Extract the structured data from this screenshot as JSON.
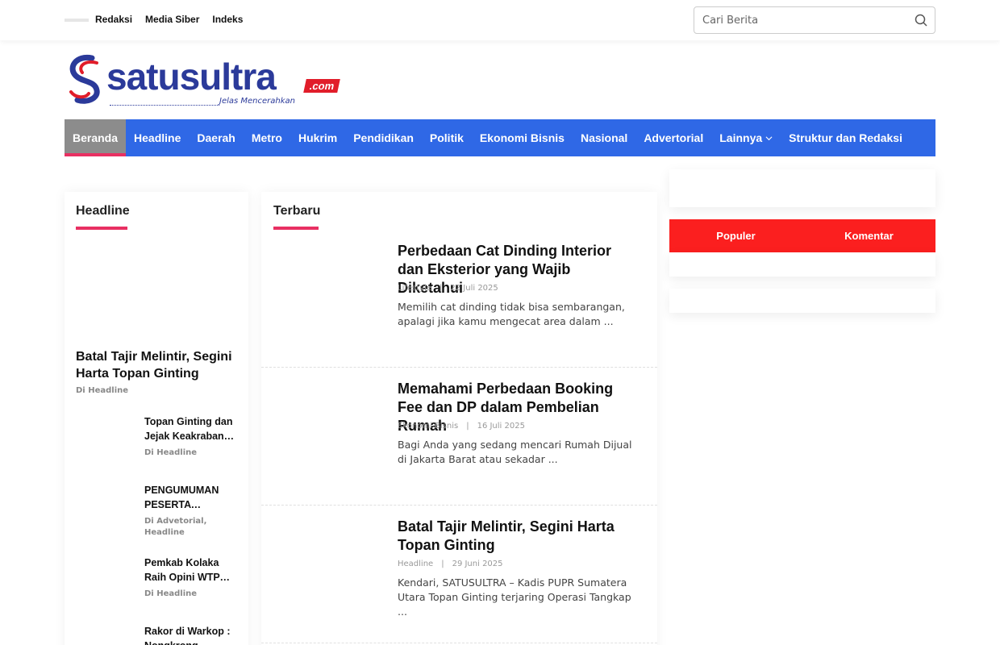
{
  "topbar": {
    "links": [
      "Redaksi",
      "Media Siber",
      "Indeks"
    ],
    "search_placeholder": "Cari Berita"
  },
  "logo": {
    "brand": "satusultra",
    "suffix": ".com",
    "tagline": "Jelas Mencerahkan",
    "colors": {
      "primary": "#2b3a9a",
      "accent": "#e11d2a"
    }
  },
  "nav": {
    "items": [
      "Beranda",
      "Headline",
      "Daerah",
      "Metro",
      "Hukrim",
      "Pendidikan",
      "Politik",
      "Ekonomi Bisnis",
      "Nasional",
      "Advertorial",
      "Lainnya",
      "Struktur dan Redaksi"
    ],
    "active": "Beranda",
    "color": "#2f68e6"
  },
  "headline_section": {
    "title": "Headline",
    "main": {
      "title": "Batal Tajir Melintir, Segini Harta Topan Ginting",
      "meta": "Di Headline"
    },
    "items": [
      {
        "title": "Topan Ginting dan Jejak Keakraban…",
        "meta": "Di Headline"
      },
      {
        "title": "PENGUMUMAN PESERTA LULUS…",
        "meta": "Di Advetorial, Headline"
      },
      {
        "title": "Pemkab Kolaka Raih Opini WTP k…",
        "meta": "Di Headline"
      },
      {
        "title": "Rakor di Warkop : Nongkrong Baren…",
        "meta": ""
      }
    ]
  },
  "latest_section": {
    "title": "Terbaru",
    "articles": [
      {
        "title": "Perbedaan Cat Dinding Interior dan Eksterior yang Wajib Diketahui",
        "category": "Lifestyle",
        "separator": "|",
        "date": "22 Juli 2025",
        "excerpt": "Memilih cat dinding tidak bisa sembarangan, apalagi jika kamu mengecat area dalam ..."
      },
      {
        "title": "Memahami Perbedaan Booking Fee dan DP dalam Pembelian Rumah",
        "category": "Ekonomi Bisnis",
        "separator": "|",
        "date": "16 Juli 2025",
        "excerpt": "Bagi Anda yang sedang mencari Rumah Dijual di Jakarta Barat atau sekadar ..."
      },
      {
        "title": "Batal Tajir Melintir, Segini Harta Topan Ginting",
        "category": "Headline",
        "separator": "|",
        "date": "29 Juni 2025",
        "excerpt": "Kendari, SATUSULTRA – Kadis PUPR Sumatera Utara Topan Ginting terjaring Operasi Tangkap ..."
      }
    ]
  },
  "sidebar": {
    "tabs": [
      "Populer",
      "Komentar"
    ],
    "tab_color": "#fb1f1f"
  },
  "accent": "#e83062"
}
